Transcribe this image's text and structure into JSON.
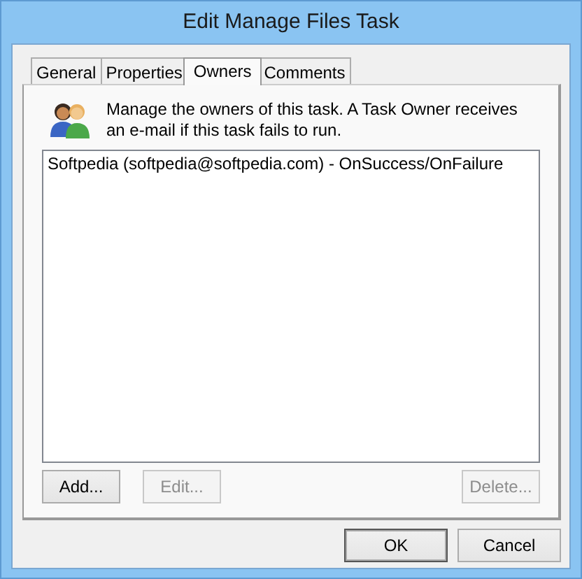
{
  "window": {
    "title": "Edit Manage Files Task"
  },
  "tabs": [
    {
      "label": "General",
      "selected": false
    },
    {
      "label": "Properties",
      "selected": false
    },
    {
      "label": "Owners",
      "selected": true
    },
    {
      "label": "Comments",
      "selected": false
    }
  ],
  "description": "Manage the owners of this task. A Task Owner receives an e-mail if this task fails to run.",
  "owners": [
    {
      "text": "Softpedia (softpedia@softpedia.com) - OnSuccess/OnFailure",
      "selected": false
    }
  ],
  "list_buttons": [
    {
      "label": "Add...",
      "disabled": false
    },
    {
      "label": "Edit...",
      "disabled": true
    },
    {
      "label": "Delete...",
      "disabled": true
    }
  ],
  "dialog_buttons": [
    {
      "label": "OK",
      "disabled": false
    },
    {
      "label": "Cancel",
      "disabled": false
    }
  ]
}
